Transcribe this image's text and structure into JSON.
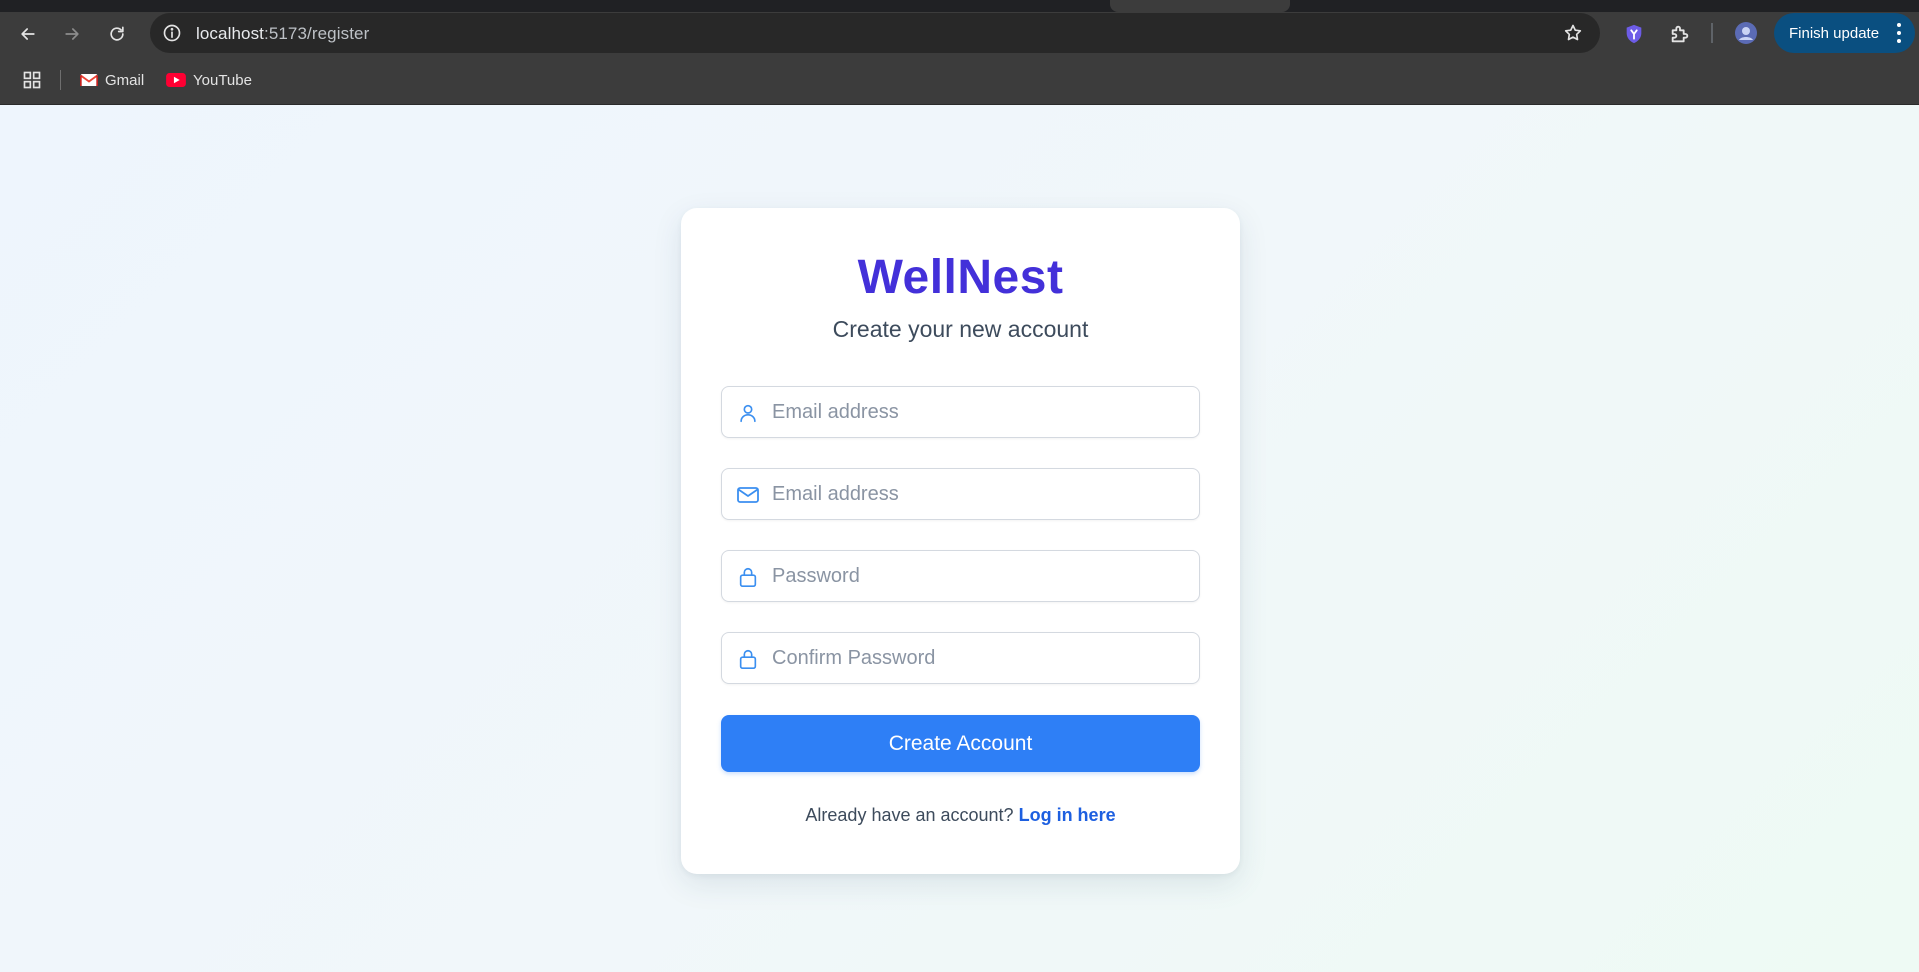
{
  "browser": {
    "url_host": "localhost",
    "url_path": ":5173/register",
    "finish_update_label": "Finish update",
    "bookmarks": [
      {
        "label": "Gmail",
        "icon": "gmail-icon"
      },
      {
        "label": "YouTube",
        "icon": "youtube-icon"
      }
    ]
  },
  "page": {
    "brand": "WellNest",
    "subtitle": "Create your new account",
    "fields": [
      {
        "icon": "user-icon",
        "placeholder": "Email address",
        "value": ""
      },
      {
        "icon": "mail-icon",
        "placeholder": "Email address",
        "value": ""
      },
      {
        "icon": "lock-icon",
        "placeholder": "Password",
        "value": ""
      },
      {
        "icon": "lock-icon",
        "placeholder": "Confirm Password",
        "value": ""
      }
    ],
    "submit_label": "Create Account",
    "login_prompt": "Already have an account?",
    "login_link": "Log in here"
  },
  "colors": {
    "brand": "#4330d9",
    "button": "#2e7ff6",
    "link": "#1d5fe0",
    "field_icon": "#3b8ff0",
    "finish_update_bg": "#0a4f80"
  }
}
